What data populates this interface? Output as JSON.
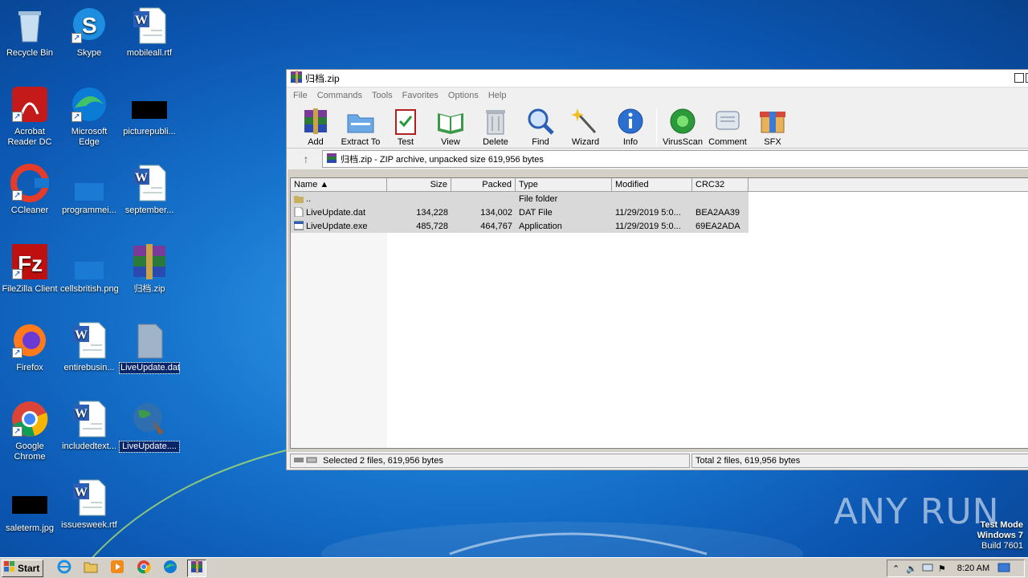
{
  "desktop_icons": [
    {
      "label": "Recycle Bin"
    },
    {
      "label": "Skype"
    },
    {
      "label": "mobileall.rtf"
    },
    {
      "label": "Acrobat Reader DC"
    },
    {
      "label": "Microsoft Edge"
    },
    {
      "label": "picturepubli..."
    },
    {
      "label": "CCleaner"
    },
    {
      "label": "programmei..."
    },
    {
      "label": "september..."
    },
    {
      "label": "FileZilla Client"
    },
    {
      "label": "cellsbritish.png"
    },
    {
      "label": "归档.zip"
    },
    {
      "label": "Firefox"
    },
    {
      "label": "entirebusin..."
    },
    {
      "label": "LiveUpdate.dat"
    },
    {
      "label": "Google Chrome"
    },
    {
      "label": "includedtext..."
    },
    {
      "label": "LiveUpdate...."
    },
    {
      "label": "saleterm.jpg"
    },
    {
      "label": "issuesweek.rtf"
    }
  ],
  "window": {
    "title": "归档.zip",
    "menu": [
      "File",
      "Commands",
      "Tools",
      "Favorites",
      "Options",
      "Help"
    ],
    "toolbar": [
      "Add",
      "Extract To",
      "Test",
      "View",
      "Delete",
      "Find",
      "Wizard",
      "Info",
      "VirusScan",
      "Comment",
      "SFX"
    ],
    "path": "归档.zip - ZIP archive, unpacked size 619,956 bytes",
    "columns": [
      "Name",
      "Size",
      "Packed",
      "Type",
      "Modified",
      "CRC32"
    ],
    "rows": [
      {
        "name": "..",
        "size": "",
        "packed": "",
        "type": "File folder",
        "modified": "",
        "crc": ""
      },
      {
        "name": "LiveUpdate.dat",
        "size": "134,228",
        "packed": "134,002",
        "type": "DAT File",
        "modified": "11/29/2019 5:0...",
        "crc": "BEA2AA39"
      },
      {
        "name": "LiveUpdate.exe",
        "size": "485,728",
        "packed": "464,767",
        "type": "Application",
        "modified": "11/29/2019 5:0...",
        "crc": "69EA2ADA"
      }
    ],
    "status_left": "Selected 2 files, 619,956 bytes",
    "status_right": "Total 2 files, 619,956 bytes"
  },
  "taskbar": {
    "start_label": "Start",
    "clock": "8:20 AM"
  },
  "watermark": {
    "line1": "Test Mode",
    "line2": "Windows 7",
    "line3": "Build 7601",
    "brand": "ANY RUN"
  },
  "colors": {
    "desktop": "#1877cf",
    "window_face": "#d4d0c8",
    "selection": "#0a246a"
  }
}
